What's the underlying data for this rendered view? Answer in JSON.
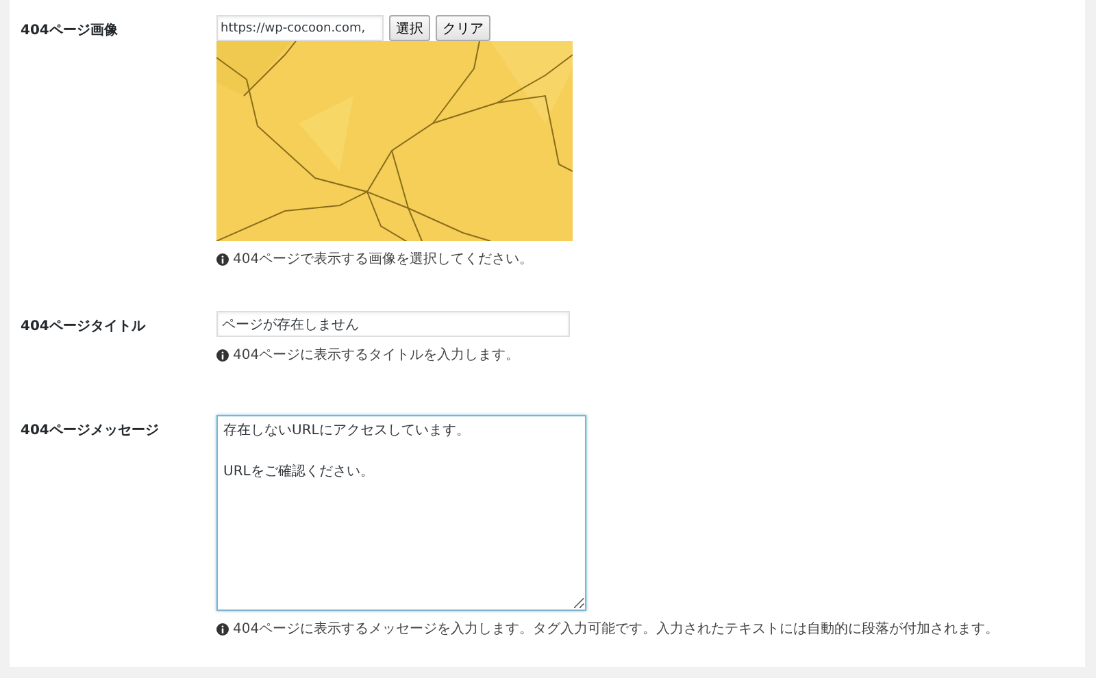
{
  "settings": [
    {
      "label": "404ページ画像",
      "value": "https://wp-cocoon.com,",
      "buttons": [
        "選択",
        "クリア"
      ],
      "image": {
        "kind": "picture"
      },
      "help": "404ページで表示する画像を選択してください。"
    },
    {
      "kind": "text",
      "label": "404ページタイトル",
      "value": "ページが存在しません",
      "help": "404ページに表示するタイトルを入力します。"
    },
    {
      "kind": "textarea",
      "label": "404ページメッセージ",
      "value": "存在しないURLにアクセスしています。\n\nURLをご確認ください。",
      "focused": true,
      "help": "404ページに表示するメッセージを入力します。タグ入力可能です。入力されたテキストには自動的に段落が付加されます。"
    }
  ]
}
